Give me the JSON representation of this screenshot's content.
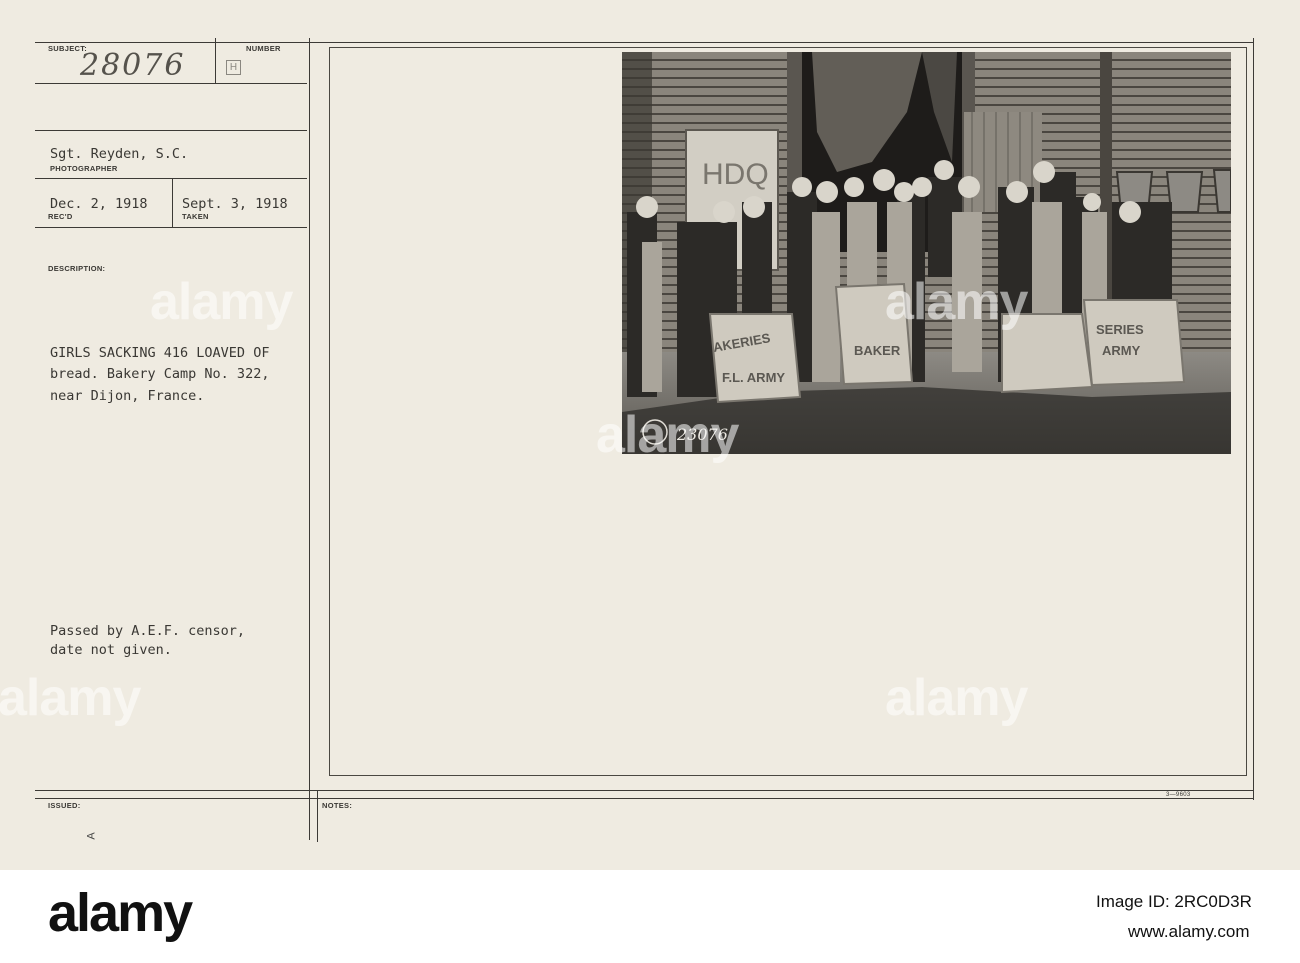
{
  "form": {
    "subject_label": "SUBJECT:",
    "number_label": "NUMBER",
    "subject_number": "28076",
    "number_mark": "H",
    "photographer_name": "Sgt. Reyden, S.C.",
    "photographer_label": "PHOTOGRAPHER",
    "rec_date": "Dec. 2, 1918",
    "rec_label": "REC'D",
    "taken_date": "Sept. 3, 1918",
    "taken_label": "TAKEN",
    "description_label": "DESCRIPTION:",
    "description_lines": [
      "GIRLS SACKING 416 LOAVED OF",
      "bread. Bakery Camp No. 322,",
      "near Dijon, France."
    ],
    "censor_lines": [
      "Passed by A.E.F. censor,",
      "date not given."
    ],
    "issued_label": "ISSUED:",
    "notes_label": "NOTES:",
    "form_code": "3—9603",
    "issued_mark": "A"
  },
  "photo": {
    "sign_text": "HDQ",
    "sack_texts": [
      "AKERIES",
      "F.L. ARMY",
      "BAKER",
      "SERIES",
      "ARMY"
    ],
    "inscription": "23076"
  },
  "watermark": {
    "text": "alamy"
  },
  "footer": {
    "logo": "alamy",
    "image_id": "Image ID: 2RC0D3R",
    "url": "www.alamy.com"
  }
}
